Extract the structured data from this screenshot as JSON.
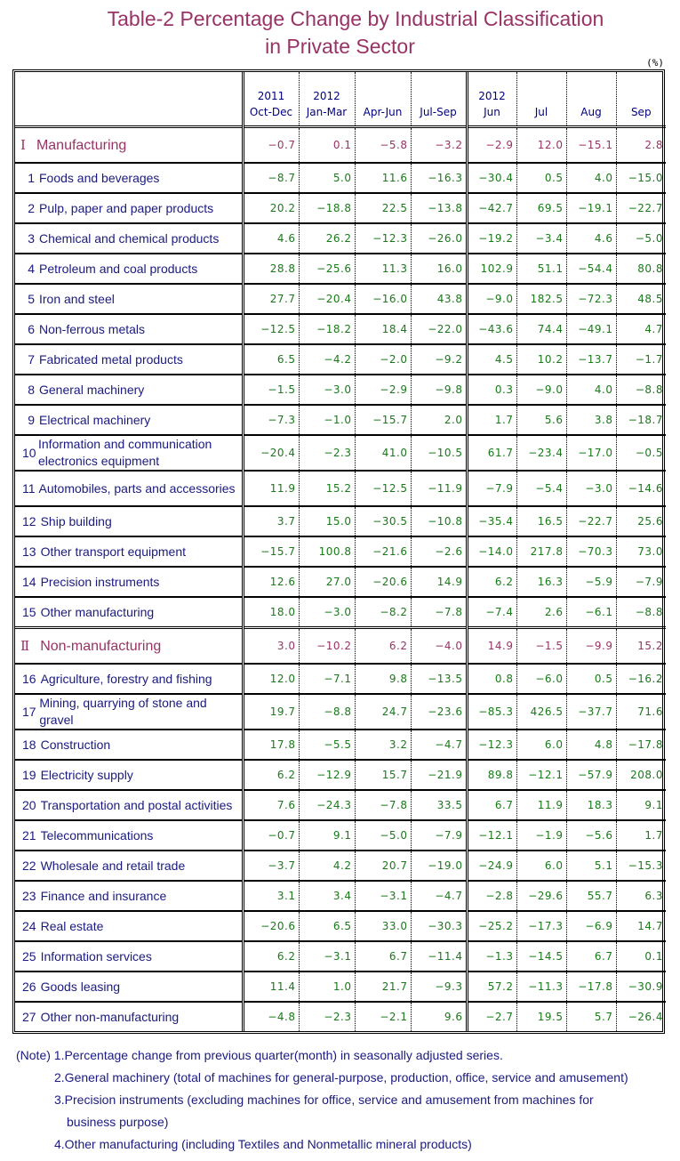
{
  "title": {
    "line1": "Table-2   Percentage Change by Industrial Classification",
    "line2": "in Private Sector"
  },
  "unit": "(%)",
  "columns": [
    {
      "year": "2011",
      "period": "Oct-Dec"
    },
    {
      "year": "2012",
      "period": "Jan-Mar"
    },
    {
      "year": "",
      "period": "Apr-Jun"
    },
    {
      "year": "",
      "period": "Jul-Sep"
    },
    {
      "year": "2012",
      "period": "Jun"
    },
    {
      "year": "",
      "period": "Jul"
    },
    {
      "year": "",
      "period": "Aug"
    },
    {
      "year": "",
      "period": "Sep"
    }
  ],
  "colors": {
    "section": "#993366",
    "value": "#1a7a1a",
    "label": "#1a1a80"
  },
  "sections": [
    {
      "roman": "Ⅰ",
      "name": "Manufacturing",
      "values": [
        "-0.7",
        "0.1",
        "-5.8",
        "-3.2",
        "-2.9",
        "12.0",
        "-15.1",
        "2.8"
      ],
      "rows": [
        {
          "num": "1",
          "label": "Foods and beverages",
          "values": [
            "-8.7",
            "5.0",
            "11.6",
            "-16.3",
            "-30.4",
            "0.5",
            "4.0",
            "-15.0"
          ]
        },
        {
          "num": "2",
          "label": "Pulp, paper and paper products",
          "values": [
            "20.2",
            "-18.8",
            "22.5",
            "-13.8",
            "-42.7",
            "69.5",
            "-19.1",
            "-22.7"
          ]
        },
        {
          "num": "3",
          "label": "Chemical and chemical products",
          "values": [
            "4.6",
            "26.2",
            "-12.3",
            "-26.0",
            "-19.2",
            "-3.4",
            "4.6",
            "-5.0"
          ]
        },
        {
          "num": "4",
          "label": "Petroleum and coal products",
          "values": [
            "28.8",
            "-25.6",
            "11.3",
            "16.0",
            "102.9",
            "51.1",
            "-54.4",
            "80.8"
          ]
        },
        {
          "num": "5",
          "label": "Iron and steel",
          "values": [
            "27.7",
            "-20.4",
            "-16.0",
            "43.8",
            "-9.0",
            "182.5",
            "-72.3",
            "48.5"
          ]
        },
        {
          "num": "6",
          "label": "Non-ferrous metals",
          "values": [
            "-12.5",
            "-18.2",
            "18.4",
            "-22.0",
            "-43.6",
            "74.4",
            "-49.1",
            "4.7"
          ]
        },
        {
          "num": "7",
          "label": "Fabricated metal products",
          "values": [
            "6.5",
            "-4.2",
            "-2.0",
            "-9.2",
            "4.5",
            "10.2",
            "-13.7",
            "-1.7"
          ]
        },
        {
          "num": "8",
          "label": "General machinery",
          "values": [
            "-1.5",
            "-3.0",
            "-2.9",
            "-9.8",
            "0.3",
            "-9.0",
            "4.0",
            "-8.8"
          ]
        },
        {
          "num": "9",
          "label": "Electrical machinery",
          "values": [
            "-7.3",
            "-1.0",
            "-15.7",
            "2.0",
            "1.7",
            "5.6",
            "3.8",
            "-18.7"
          ]
        },
        {
          "num": "10",
          "label": "Information and communication electronics equipment",
          "values": [
            "-20.4",
            "-2.3",
            "41.0",
            "-10.5",
            "61.7",
            "-23.4",
            "-17.0",
            "-0.5"
          ]
        },
        {
          "num": "11",
          "label": "Automobiles, parts and accessories",
          "values": [
            "11.9",
            "15.2",
            "-12.5",
            "-11.9",
            "-7.9",
            "-5.4",
            "-3.0",
            "-14.6"
          ]
        },
        {
          "num": "12",
          "label": "Ship building",
          "values": [
            "3.7",
            "15.0",
            "-30.5",
            "-10.8",
            "-35.4",
            "16.5",
            "-22.7",
            "25.6"
          ]
        },
        {
          "num": "13",
          "label": "Other transport equipment",
          "values": [
            "-15.7",
            "100.8",
            "-21.6",
            "-2.6",
            "-14.0",
            "217.8",
            "-70.3",
            "73.0"
          ]
        },
        {
          "num": "14",
          "label": "Precision instruments",
          "values": [
            "12.6",
            "27.0",
            "-20.6",
            "14.9",
            "6.2",
            "16.3",
            "-5.9",
            "-7.9"
          ]
        },
        {
          "num": "15",
          "label": "Other manufacturing",
          "values": [
            "18.0",
            "-3.0",
            "-8.2",
            "-7.8",
            "-7.4",
            "2.6",
            "-6.1",
            "-8.8"
          ]
        }
      ]
    },
    {
      "roman": "Ⅱ",
      "name": "Non-manufacturing",
      "values": [
        "3.0",
        "-10.2",
        "6.2",
        "-4.0",
        "14.9",
        "-1.5",
        "-9.9",
        "15.2"
      ],
      "rows": [
        {
          "num": "16",
          "label": "Agriculture, forestry and fishing",
          "values": [
            "12.0",
            "-7.1",
            "9.8",
            "-13.5",
            "0.8",
            "-6.0",
            "0.5",
            "-16.2"
          ]
        },
        {
          "num": "17",
          "label": "Mining, quarrying of stone and gravel",
          "values": [
            "19.7",
            "-8.8",
            "24.7",
            "-23.6",
            "-85.3",
            "426.5",
            "-37.7",
            "71.6"
          ]
        },
        {
          "num": "18",
          "label": "Construction",
          "values": [
            "17.8",
            "-5.5",
            "3.2",
            "-4.7",
            "-12.3",
            "6.0",
            "4.8",
            "-17.8"
          ]
        },
        {
          "num": "19",
          "label": "Electricity supply",
          "values": [
            "6.2",
            "-12.9",
            "15.7",
            "-21.9",
            "89.8",
            "-12.1",
            "-57.9",
            "208.0"
          ]
        },
        {
          "num": "20",
          "label": "Transportation and postal activities",
          "values": [
            "7.6",
            "-24.3",
            "-7.8",
            "33.5",
            "6.7",
            "11.9",
            "18.3",
            "9.1"
          ]
        },
        {
          "num": "21",
          "label": "Telecommunications",
          "values": [
            "-0.7",
            "9.1",
            "-5.0",
            "-7.9",
            "-12.1",
            "-1.9",
            "-5.6",
            "1.7"
          ]
        },
        {
          "num": "22",
          "label": "Wholesale and retail trade",
          "values": [
            "-3.7",
            "4.2",
            "20.7",
            "-19.0",
            "-24.9",
            "6.0",
            "5.1",
            "-15.3"
          ]
        },
        {
          "num": "23",
          "label": "Finance and insurance",
          "values": [
            "3.1",
            "3.4",
            "-3.1",
            "-4.7",
            "-2.8",
            "-29.6",
            "55.7",
            "6.3"
          ]
        },
        {
          "num": "24",
          "label": "Real estate",
          "values": [
            "-20.6",
            "6.5",
            "33.0",
            "-30.3",
            "-25.2",
            "-17.3",
            "-6.9",
            "14.7"
          ]
        },
        {
          "num": "25",
          "label": "Information services",
          "values": [
            "6.2",
            "-3.1",
            "6.7",
            "-11.4",
            "-1.3",
            "-14.5",
            "6.7",
            "0.1"
          ]
        },
        {
          "num": "26",
          "label": "Goods leasing",
          "values": [
            "11.4",
            "1.0",
            "21.7",
            "-9.3",
            "57.2",
            "-11.3",
            "-17.8",
            "-30.9"
          ]
        },
        {
          "num": "27",
          "label": "Other non-manufacturing",
          "values": [
            "-4.8",
            "-2.3",
            "-2.1",
            "9.6",
            "-2.7",
            "19.5",
            "5.7",
            "-26.4"
          ]
        }
      ]
    }
  ],
  "notes": [
    "(Note) 1.Percentage change from previous quarter(month) in seasonally adjusted series.",
    "2.General machinery (total of machines for general-purpose, production, office, service and amusement)",
    "3.Precision instruments (excluding machines for office, service and amusement from machines for",
    "business purpose)",
    "4.Other manufacturing (including Textiles and Nonmetallic mineral products)"
  ]
}
